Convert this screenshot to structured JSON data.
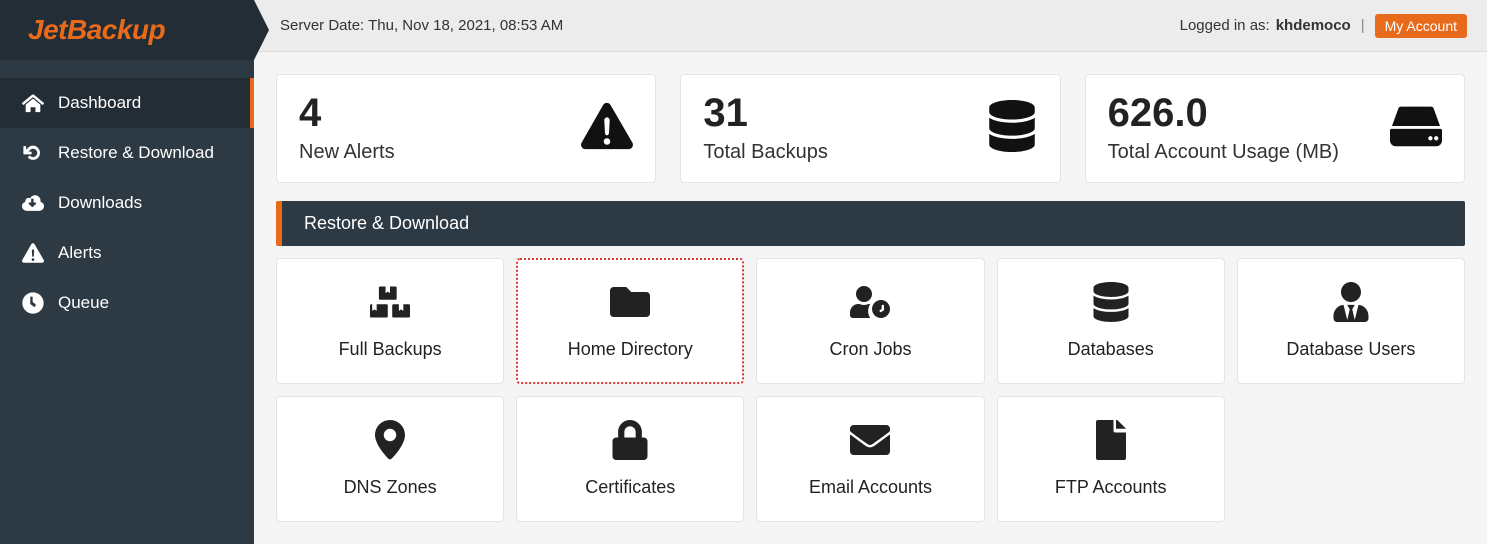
{
  "brand": "JetBackup",
  "topbar": {
    "server_date_label": "Server Date: Thu, Nov 18, 2021, 08:53 AM",
    "logged_in_prefix": "Logged in as: ",
    "username": "khdemoco",
    "separator": " | ",
    "my_account_label": "My Account"
  },
  "sidebar": {
    "items": [
      {
        "label": "Dashboard",
        "icon": "home-icon",
        "active": true
      },
      {
        "label": "Restore & Download",
        "icon": "restore-icon",
        "active": false
      },
      {
        "label": "Downloads",
        "icon": "cloud-download-icon",
        "active": false
      },
      {
        "label": "Alerts",
        "icon": "alert-icon",
        "active": false
      },
      {
        "label": "Queue",
        "icon": "clock-icon",
        "active": false
      }
    ]
  },
  "stats": [
    {
      "value": "4",
      "label": "New Alerts",
      "icon": "alert-icon"
    },
    {
      "value": "31",
      "label": "Total Backups",
      "icon": "database-icon"
    },
    {
      "value": "626.0",
      "label": "Total Account Usage (MB)",
      "icon": "disk-icon"
    }
  ],
  "section_title": "Restore & Download",
  "tiles_row1": [
    {
      "label": "Full Backups",
      "icon": "boxes-icon"
    },
    {
      "label": "Home Directory",
      "icon": "folder-icon",
      "highlight": true
    },
    {
      "label": "Cron Jobs",
      "icon": "user-clock-icon"
    },
    {
      "label": "Databases",
      "icon": "database-icon"
    },
    {
      "label": "Database Users",
      "icon": "user-tie-icon"
    }
  ],
  "tiles_row2": [
    {
      "label": "DNS Zones",
      "icon": "map-pin-icon"
    },
    {
      "label": "Certificates",
      "icon": "lock-icon"
    },
    {
      "label": "Email Accounts",
      "icon": "envelope-icon"
    },
    {
      "label": "FTP Accounts",
      "icon": "file-icon"
    }
  ]
}
